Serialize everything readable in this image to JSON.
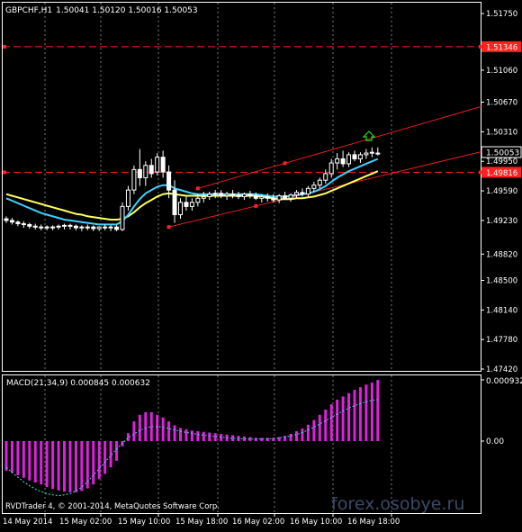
{
  "header": {
    "symbol": "GBPCHF,H1",
    "ohlc": "1.50041 1.50120 1.50016 1.50053"
  },
  "colors": {
    "background": "#000000",
    "grid": "#ffffff",
    "axis_text": "#ffffff",
    "candle": "#ffffff",
    "hline": "#ff2020",
    "trend": "#ff2020",
    "ma_fast": "#40d0ff",
    "ma_slow": "#ffff60",
    "macd_hist": "#e020e0",
    "macd_signal": "#40e0e0",
    "buy_arrow": "#20e020",
    "watermark": "#3a4a66"
  },
  "price_axis": {
    "ticks": [
      "1.51750",
      "1.51060",
      "1.50670",
      "1.50310",
      "1.49950",
      "1.49590",
      "1.49230",
      "1.48820",
      "1.48500",
      "1.48140",
      "1.47780",
      "1.47420"
    ],
    "ticks_numeric": [
      1.5175,
      1.5106,
      1.5067,
      1.5031,
      1.4995,
      1.4959,
      1.4923,
      1.4882,
      1.485,
      1.4814,
      1.4778,
      1.4742
    ],
    "current_price": "1.50053",
    "current_price_numeric": 1.50053,
    "levels": [
      {
        "label": "1.51346",
        "value": 1.51346
      },
      {
        "label": "1.49816",
        "value": 1.49816
      }
    ]
  },
  "time_axis": {
    "labels": [
      "14 May 2014",
      "15 May 02:00",
      "15 May 10:00",
      "15 May 18:00",
      "16 May 02:00",
      "16 May 10:00",
      "16 May 18:00"
    ]
  },
  "macd": {
    "label": "MACD(21,34,9) 0.000845 0.000632",
    "ticks": [
      "0.000932",
      "0.00"
    ]
  },
  "footer": {
    "copyright": "RVDTrader 4, © 2001-2014, MetaQuotes Software Corp.",
    "watermark": "forex.osobye.ru"
  },
  "chart_data": {
    "type": "candlestick",
    "symbol": "GBPCHF",
    "timeframe": "H1",
    "ohlc": [
      [
        1.4925,
        1.4928,
        1.492,
        1.4923
      ],
      [
        1.4923,
        1.4926,
        1.4918,
        1.4921
      ],
      [
        1.4921,
        1.4923,
        1.4916,
        1.4919
      ],
      [
        1.4919,
        1.4922,
        1.4914,
        1.4918
      ],
      [
        1.4918,
        1.492,
        1.4913,
        1.4916
      ],
      [
        1.4916,
        1.4919,
        1.4912,
        1.4915
      ],
      [
        1.4915,
        1.4918,
        1.4911,
        1.4915
      ],
      [
        1.4915,
        1.4917,
        1.4911,
        1.4914
      ],
      [
        1.4914,
        1.4917,
        1.4911,
        1.4915
      ],
      [
        1.4915,
        1.4918,
        1.4912,
        1.4916
      ],
      [
        1.4916,
        1.4919,
        1.4912,
        1.4917
      ],
      [
        1.4917,
        1.4919,
        1.4912,
        1.4916
      ],
      [
        1.4916,
        1.4918,
        1.4911,
        1.4914
      ],
      [
        1.4914,
        1.4917,
        1.491,
        1.4915
      ],
      [
        1.4915,
        1.4918,
        1.4911,
        1.4915
      ],
      [
        1.4915,
        1.4917,
        1.491,
        1.4913
      ],
      [
        1.4913,
        1.4916,
        1.491,
        1.4915
      ],
      [
        1.4915,
        1.4918,
        1.4911,
        1.4914
      ],
      [
        1.4914,
        1.4917,
        1.491,
        1.4915
      ],
      [
        1.4915,
        1.4917,
        1.491,
        1.4912
      ],
      [
        1.4912,
        1.4945,
        1.491,
        1.494
      ],
      [
        1.494,
        1.4965,
        1.4935,
        1.496
      ],
      [
        1.496,
        1.499,
        1.4955,
        1.4985
      ],
      [
        1.4985,
        1.501,
        1.4965,
        1.4975
      ],
      [
        1.4975,
        1.4995,
        1.4965,
        1.499
      ],
      [
        1.499,
        1.4998,
        1.4975,
        1.498
      ],
      [
        1.4982,
        1.5005,
        1.4978,
        1.5
      ],
      [
        1.5,
        1.5008,
        1.4975,
        1.4982
      ],
      [
        1.4982,
        1.499,
        1.495,
        1.496
      ],
      [
        1.496,
        1.4972,
        1.492,
        1.493
      ],
      [
        1.493,
        1.495,
        1.4925,
        1.4945
      ],
      [
        1.4945,
        1.4952,
        1.4935,
        1.494
      ],
      [
        1.494,
        1.495,
        1.4935,
        1.4945
      ],
      [
        1.4945,
        1.4955,
        1.494,
        1.495
      ],
      [
        1.495,
        1.4958,
        1.4945,
        1.4952
      ],
      [
        1.4952,
        1.4958,
        1.4948,
        1.4955
      ],
      [
        1.4955,
        1.496,
        1.495,
        1.4956
      ],
      [
        1.4956,
        1.496,
        1.495,
        1.4953
      ],
      [
        1.4953,
        1.4958,
        1.4948,
        1.4955
      ],
      [
        1.4955,
        1.496,
        1.495,
        1.4954
      ],
      [
        1.4954,
        1.4958,
        1.4949,
        1.4952
      ],
      [
        1.4952,
        1.4957,
        1.4948,
        1.4955
      ],
      [
        1.4955,
        1.4959,
        1.495,
        1.4953
      ],
      [
        1.4953,
        1.4957,
        1.4948,
        1.495
      ],
      [
        1.495,
        1.4955,
        1.4945,
        1.4952
      ],
      [
        1.4952,
        1.4956,
        1.4946,
        1.495
      ],
      [
        1.495,
        1.4955,
        1.4945,
        1.4948
      ],
      [
        1.4948,
        1.4955,
        1.4944,
        1.4953
      ],
      [
        1.4953,
        1.4958,
        1.4948,
        1.495
      ],
      [
        1.495,
        1.4956,
        1.4946,
        1.4954
      ],
      [
        1.4954,
        1.496,
        1.495,
        1.4957
      ],
      [
        1.4957,
        1.4962,
        1.4952,
        1.4955
      ],
      [
        1.4955,
        1.4965,
        1.4952,
        1.4962
      ],
      [
        1.4962,
        1.497,
        1.4958,
        1.4966
      ],
      [
        1.4966,
        1.4975,
        1.4962,
        1.4972
      ],
      [
        1.4972,
        1.4985,
        1.4968,
        1.498
      ],
      [
        1.498,
        1.4998,
        1.4975,
        1.4993
      ],
      [
        1.4993,
        1.5005,
        1.4985,
        1.4998
      ],
      [
        1.4998,
        1.5008,
        1.4988,
        1.4992
      ],
      [
        1.4992,
        1.5006,
        1.4988,
        1.5003
      ],
      [
        1.5003,
        1.5008,
        1.4995,
        1.4998
      ],
      [
        1.4998,
        1.5006,
        1.4993,
        1.5003
      ],
      [
        1.5003,
        1.501,
        1.4998,
        1.5005
      ],
      [
        1.5005,
        1.5012,
        1.5,
        1.5006
      ],
      [
        1.5004,
        1.5012,
        1.5002,
        1.5005
      ]
    ],
    "ma_fast": [
      1.495,
      1.4947,
      1.4944,
      1.4941,
      1.4938,
      1.4935,
      1.4932,
      1.493,
      1.4928,
      1.4926,
      1.4924,
      1.4923,
      1.4922,
      1.4921,
      1.492,
      1.4919,
      1.4918,
      1.4918,
      1.4918,
      1.4918,
      1.4922,
      1.493,
      1.494,
      1.4949,
      1.4956,
      1.496,
      1.4964,
      1.4966,
      1.4966,
      1.4962,
      1.496,
      1.4958,
      1.4956,
      1.4955,
      1.4955,
      1.4955,
      1.4955,
      1.4955,
      1.4955,
      1.4955,
      1.4955,
      1.4955,
      1.4955,
      1.4955,
      1.4954,
      1.4953,
      1.4952,
      1.4952,
      1.4952,
      1.4953,
      1.4954,
      1.4955,
      1.4956,
      1.4958,
      1.4961,
      1.4965,
      1.497,
      1.4975,
      1.4979,
      1.4983,
      1.4986,
      1.4989,
      1.4992,
      1.4995,
      1.4998
    ],
    "ma_slow": [
      1.4955,
      1.4953,
      1.4951,
      1.4949,
      1.4947,
      1.4945,
      1.4943,
      1.4941,
      1.4939,
      1.4937,
      1.4935,
      1.4933,
      1.4931,
      1.493,
      1.4928,
      1.4927,
      1.4926,
      1.4925,
      1.4924,
      1.4924,
      1.4925,
      1.4928,
      1.4933,
      1.4939,
      1.4944,
      1.4948,
      1.4952,
      1.4955,
      1.4956,
      1.4955,
      1.4954,
      1.4953,
      1.4953,
      1.4953,
      1.4953,
      1.4953,
      1.4953,
      1.4953,
      1.4953,
      1.4953,
      1.4953,
      1.4953,
      1.4953,
      1.4953,
      1.4952,
      1.4951,
      1.495,
      1.4949,
      1.4949,
      1.4949,
      1.495,
      1.495,
      1.4951,
      1.4952,
      1.4954,
      1.4956,
      1.4959,
      1.4962,
      1.4965,
      1.4968,
      1.4971,
      1.4974,
      1.4977,
      1.498,
      1.4983
    ],
    "macd_hist": [
      -0.00045,
      -0.00048,
      -0.00052,
      -0.00056,
      -0.0006,
      -0.00063,
      -0.00066,
      -0.0007,
      -0.00073,
      -0.00075,
      -0.00077,
      -0.00078,
      -0.00078,
      -0.00076,
      -0.00072,
      -0.00066,
      -0.00058,
      -0.0005,
      -0.0004,
      -0.0003,
      -8e-05,
      0.00012,
      0.0003,
      0.0004,
      0.00044,
      0.00044,
      0.0004,
      0.00036,
      0.0003,
      0.00024,
      0.0002,
      0.00018,
      0.00016,
      0.00015,
      0.00014,
      0.00013,
      0.00012,
      0.00011,
      0.0001,
      9e-05,
      8e-05,
      7e-05,
      6e-05,
      5e-05,
      5e-05,
      5e-05,
      5e-05,
      6e-05,
      8e-05,
      0.00011,
      0.00015,
      0.00019,
      0.00025,
      0.00032,
      0.0004,
      0.00048,
      0.00056,
      0.00063,
      0.00068,
      0.00073,
      0.00078,
      0.00082,
      0.00086,
      0.00089,
      0.00093
    ],
    "macd_signal": [
      -0.0004,
      -0.00048,
      -0.00055,
      -0.00062,
      -0.00068,
      -0.00073,
      -0.00077,
      -0.0008,
      -0.00082,
      -0.00083,
      -0.00082,
      -0.0008,
      -0.00076,
      -0.0007,
      -0.00062,
      -0.00052,
      -0.00042,
      -0.00032,
      -0.00022,
      -0.00012,
      -3e-05,
      5e-05,
      0.00011,
      0.00016,
      0.0002,
      0.00022,
      0.00022,
      0.00021,
      0.00019,
      0.00017,
      0.00015,
      0.00013,
      0.00012,
      0.0001,
      9e-05,
      8e-05,
      7e-05,
      6e-05,
      5e-05,
      4e-05,
      4e-05,
      3e-05,
      3e-05,
      3e-05,
      3e-05,
      3e-05,
      4e-05,
      5e-05,
      6e-05,
      8e-05,
      0.0001,
      0.00013,
      0.00017,
      0.00021,
      0.00026,
      0.00031,
      0.00036,
      0.00041,
      0.00046,
      0.0005,
      0.00054,
      0.00057,
      0.0006,
      0.00062,
      0.00063
    ],
    "trend_upper": {
      "from_index": 33,
      "from_price": 1.4962,
      "to_index": 82,
      "to_price": 1.5062
    },
    "trend_lower": {
      "from_index": 28,
      "from_price": 1.4915,
      "to_index": 82,
      "to_price": 1.5007
    },
    "xlim_price": [
      1.4742,
      1.5175
    ],
    "ylim_macd": [
      -0.00085,
      0.000932
    ]
  }
}
